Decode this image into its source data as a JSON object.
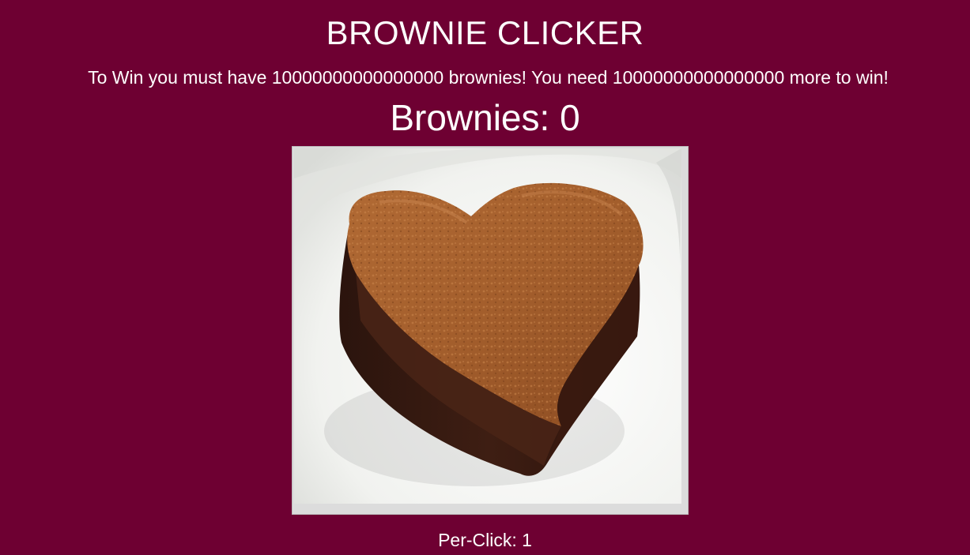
{
  "game": {
    "title": "BROWNIE CLICKER",
    "win_message": "To Win you must have 10000000000000000 brownies! You need 10000000000000000 more to win!",
    "brownies_label": "Brownies: 0",
    "per_click_label": "Per-Click: 1",
    "brownie_image": "heart-shaped-brownie-on-plate"
  },
  "colors": {
    "background": "#6e0032",
    "text": "#ffffff",
    "brownie_top": "#a4602e",
    "brownie_side": "#3a1c12",
    "plate": "#f4f4f2"
  }
}
